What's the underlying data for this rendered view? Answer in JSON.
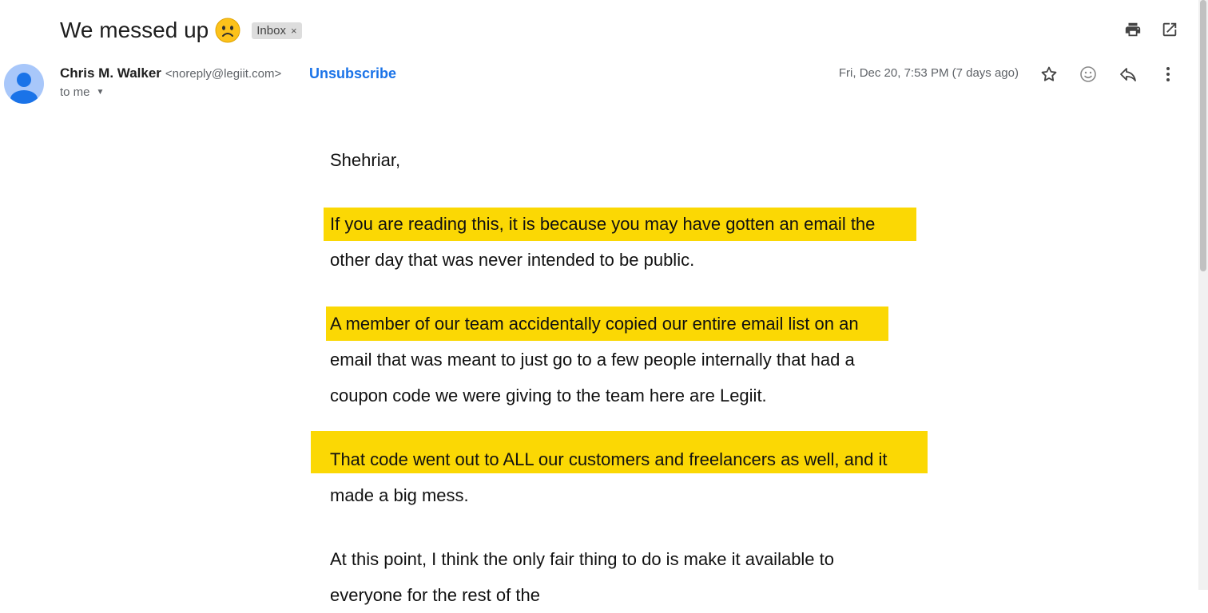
{
  "email": {
    "subject": "We messed up",
    "label_chip": "Inbox",
    "sender_name": "Chris M. Walker",
    "sender_email": "<noreply@legiit.com>",
    "unsubscribe_label": "Unsubscribe",
    "recipient": "to me",
    "date": "Fri, Dec 20, 7:53 PM (7 days ago)"
  },
  "body": {
    "greeting": "Shehriar,",
    "p1_line1": "If you are reading this, it is because you may have gotten an email the",
    "p1_line2": "other day that was never intended to be public.",
    "p2_line1": "A member of our team accidentally copied our entire email list on an",
    "p2_line2": "email that was meant to just go to a few people internally that had a",
    "p2_line3": "coupon code we were giving to the team here are Legiit.",
    "p3_line1": "That code went out to ALL our customers and freelancers as well, and it",
    "p3_line2": "made a big mess.",
    "p4_line1": "At this point, I think the only fair thing to do is make it available to",
    "p4_line2": "everyone for the rest of the"
  },
  "icons": {
    "subject_emoji": "frowning-face-icon",
    "print": "print-icon",
    "popout": "open-in-new-window-icon",
    "star": "star-icon",
    "emoji_react": "add-reaction-icon",
    "reply": "reply-icon",
    "more": "more-vert-icon"
  },
  "colors": {
    "highlight": "#fbd804",
    "link": "#1a73e8",
    "avatar_bg": "#a8c7fa",
    "avatar_fg": "#1a73e8"
  }
}
